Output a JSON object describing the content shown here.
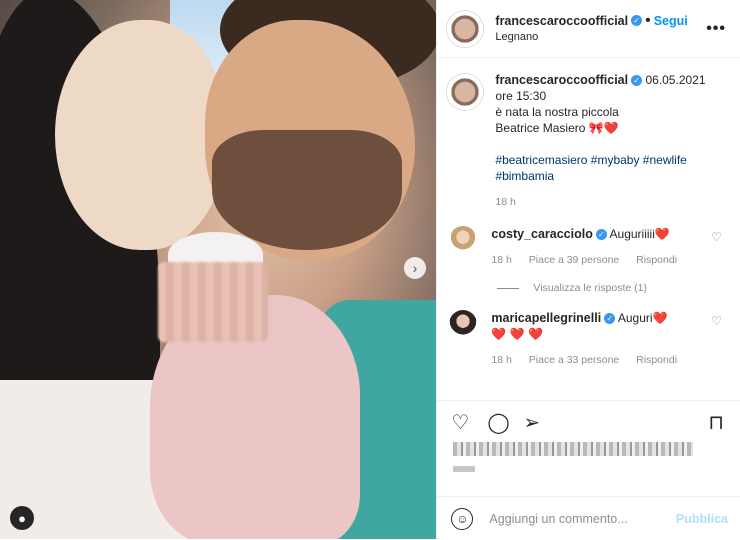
{
  "post": {
    "username": "francescaroccoofficial",
    "follow_label": "Segui",
    "location": "Legnano",
    "more_glyph": "•••"
  },
  "caption": {
    "username": "francescaroccoofficial",
    "date": "06.05.2021",
    "time": "ore 15:30",
    "line1": "è nata la nostra piccola",
    "line2": "Beatrice Masiero",
    "emoji": "🎀❤️",
    "hashtags_1": "#beatricemasiero #mybaby #newlife",
    "hashtags_2": "#bimbamia",
    "age": "18 h"
  },
  "comments": [
    {
      "username": "costy_caracciolo",
      "text": "Augurіiiii",
      "emoji": "❤️",
      "age": "18 h",
      "likes": "Piace a 39 persone",
      "reply": "Rispondi"
    },
    {
      "username": "maricapellegrinelli",
      "text": "Auguri",
      "emoji": "❤️",
      "emoji_line": "❤️ ❤️ ❤️",
      "age": "18 h",
      "likes": "Piace a 33 persone",
      "reply": "Rispondi"
    }
  ],
  "view_replies": "Visualizza le risposte (1)",
  "add_comment": {
    "placeholder": "Aggiungi un commento...",
    "publish": "Pubblica"
  }
}
